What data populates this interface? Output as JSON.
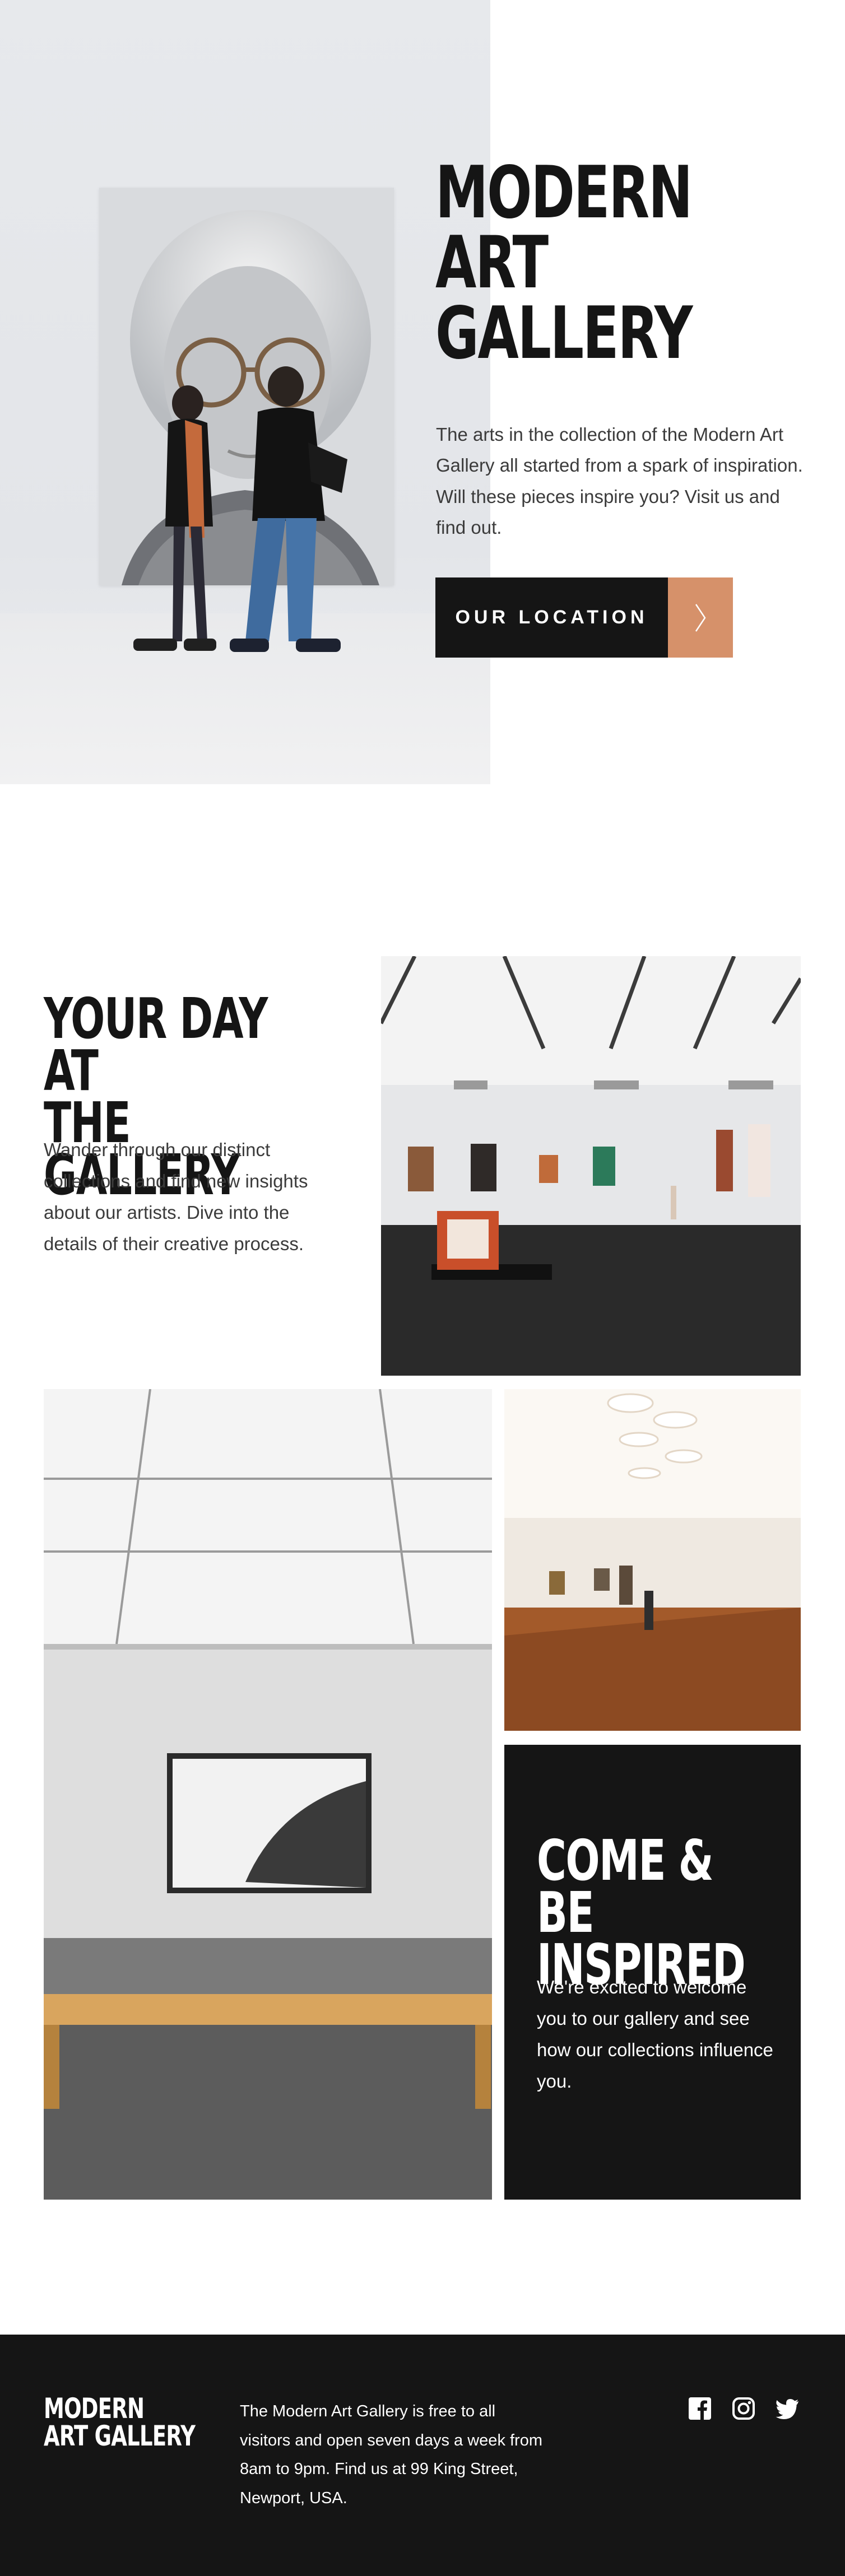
{
  "hero": {
    "title_lines": [
      "MODERN",
      "ART",
      "GALLERY"
    ],
    "description": "The arts in the collection of the Modern Art Gallery all started from a spark of inspiration. Will these pieces inspire you? Visit us and find out.",
    "location_button": "OUR LOCATION",
    "arrow_icon": "chevron-right-icon"
  },
  "gallery_section": {
    "title_lines": [
      "YOUR DAY AT",
      "THE GALLERY"
    ],
    "description": "Wander through our distinct collections and find new insights about our artists. Dive into the details of their creative process."
  },
  "inspire_section": {
    "title_lines": [
      "COME & BE",
      "INSPIRED"
    ],
    "description": "We're excited to welcome you to our gallery and see how our collections influence you."
  },
  "footer": {
    "logo_lines": [
      "MODERN",
      "ART GALLERY"
    ],
    "description": "The Modern Art Gallery is free to all visitors and open seven days a week from 8am to 9pm. Find us at 99 King Street, Newport, USA.",
    "social_icons": [
      "facebook-icon",
      "instagram-icon",
      "twitter-icon"
    ]
  },
  "colors": {
    "dark": "#151515",
    "accent": "#d6916a",
    "body_text": "#3b3b3b",
    "white": "#ffffff"
  }
}
